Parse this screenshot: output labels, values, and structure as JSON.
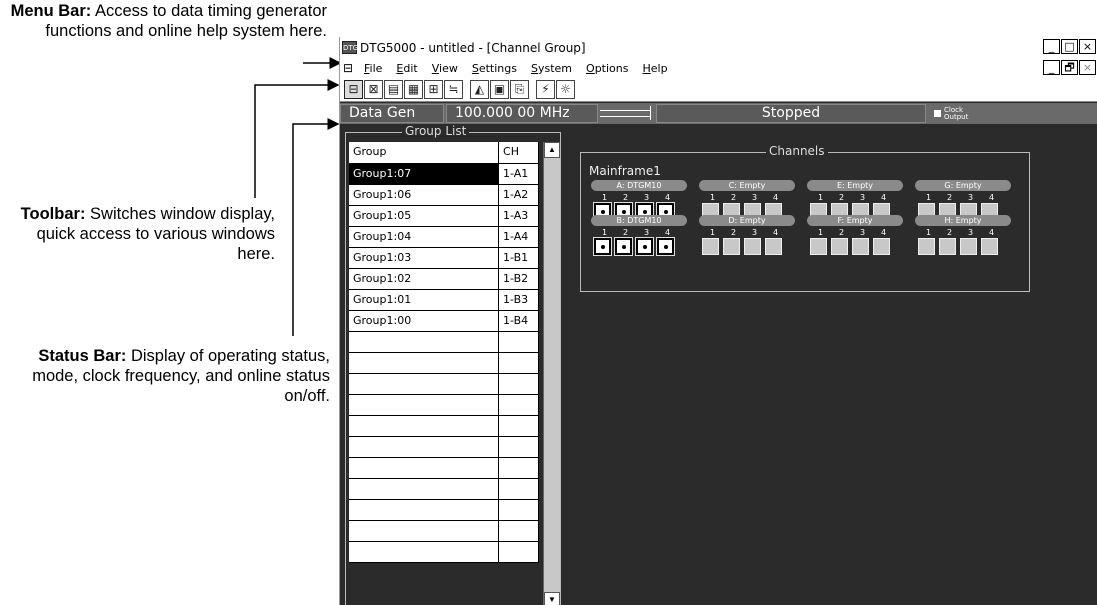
{
  "callouts": {
    "menu_bar": {
      "title": "Menu Bar:",
      "text": "Access to data timing generator functions and online help system here."
    },
    "toolbar": {
      "title": "Toolbar:",
      "text": "Switches window display, quick access to various windows here."
    },
    "status_bar": {
      "title": "Status Bar:",
      "text": "Display of operating status, mode, clock frequency, and online status on/off."
    }
  },
  "window": {
    "app_icon": "DTG",
    "title": "DTG5000 - untitled - [Channel Group]",
    "buttons": [
      "_",
      "□",
      "×"
    ],
    "child_buttons": [
      "_",
      "🗗",
      "×"
    ]
  },
  "menu": {
    "icon": "channel-group-icon",
    "items": [
      {
        "ul": "F",
        "rest": "ile"
      },
      {
        "ul": "E",
        "rest": "dit"
      },
      {
        "ul": "V",
        "rest": "iew"
      },
      {
        "ul": "S",
        "rest": "ettings"
      },
      {
        "ul": "S",
        "rest": "ystem"
      },
      {
        "ul": "O",
        "rest": "ptions"
      },
      {
        "ul": "H",
        "rest": "elp"
      }
    ]
  },
  "toolbar": {
    "icons": [
      "channel-group-icon",
      "timing-icon",
      "listing-icon",
      "waveform-icon",
      "sequence-icon",
      "subsequence-icon",
      "pattern-icon",
      "level-icon",
      "setup-icon",
      "jitter-icon",
      "probe-icon"
    ],
    "glyphs": [
      "⊟",
      "⊠",
      "▤",
      "▦",
      "⊞",
      "≒",
      "◭",
      "▣",
      "⎘",
      "⚡",
      "☼"
    ]
  },
  "status": {
    "mode": "Data Gen",
    "frequency": "100.000 00 MHz",
    "state": "Stopped",
    "clock_output_line1": "Clock",
    "clock_output_line2": "Output"
  },
  "group_list": {
    "title": "Group List",
    "headers": {
      "group": "Group",
      "ch": "CH"
    },
    "rows": [
      {
        "group": "Group1:07",
        "ch": "1-A1"
      },
      {
        "group": "Group1:06",
        "ch": "1-A2"
      },
      {
        "group": "Group1:05",
        "ch": "1-A3"
      },
      {
        "group": "Group1:04",
        "ch": "1-A4"
      },
      {
        "group": "Group1:03",
        "ch": "1-B1"
      },
      {
        "group": "Group1:02",
        "ch": "1-B2"
      },
      {
        "group": "Group1:01",
        "ch": "1-B3"
      },
      {
        "group": "Group1:00",
        "ch": "1-B4"
      }
    ],
    "selected_index": 0,
    "empty_rows": 11
  },
  "channels": {
    "title": "Channels",
    "mainframe": "Mainframe1",
    "channel_numbers": [
      "1",
      "2",
      "3",
      "4"
    ],
    "slots": [
      {
        "label": "A: DTGM10",
        "active": [
          true,
          true,
          true,
          true
        ]
      },
      {
        "label": "C: Empty",
        "active": [
          false,
          false,
          false,
          false
        ]
      },
      {
        "label": "E: Empty",
        "active": [
          false,
          false,
          false,
          false
        ]
      },
      {
        "label": "G: Empty",
        "active": [
          false,
          false,
          false,
          false
        ]
      },
      {
        "label": "B: DTGM10",
        "active": [
          true,
          true,
          true,
          true
        ]
      },
      {
        "label": "D: Empty",
        "active": [
          false,
          false,
          false,
          false
        ]
      },
      {
        "label": "F: Empty",
        "active": [
          false,
          false,
          false,
          false
        ]
      },
      {
        "label": "H: Empty",
        "active": [
          false,
          false,
          false,
          false
        ]
      }
    ]
  }
}
